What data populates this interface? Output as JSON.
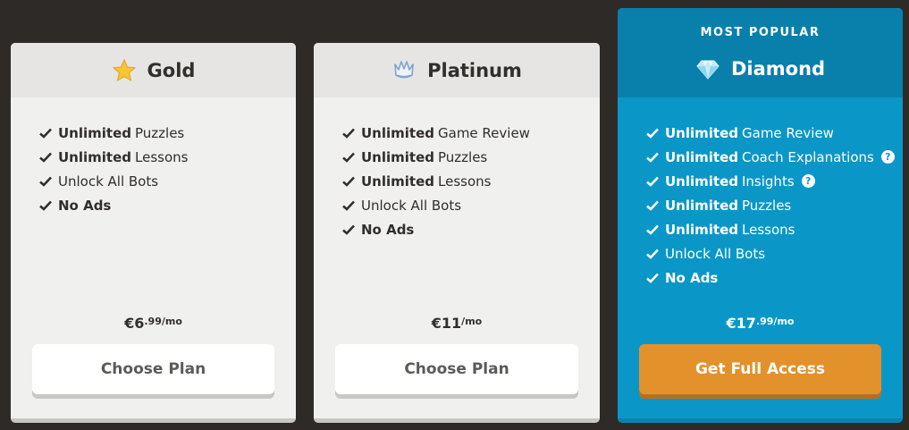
{
  "plans": [
    {
      "name": "Gold",
      "icon": "star-icon",
      "features": [
        {
          "bold": "Unlimited",
          "text": "Puzzles"
        },
        {
          "bold": "Unlimited",
          "text": "Lessons"
        },
        {
          "bold": "",
          "text": "Unlock All Bots"
        },
        {
          "bold": "No Ads",
          "text": ""
        }
      ],
      "price_main": "€6",
      "price_cents": ".99/mo",
      "button": "Choose Plan"
    },
    {
      "name": "Platinum",
      "icon": "crown-icon",
      "features": [
        {
          "bold": "Unlimited",
          "text": "Game Review"
        },
        {
          "bold": "Unlimited",
          "text": "Puzzles"
        },
        {
          "bold": "Unlimited",
          "text": "Lessons"
        },
        {
          "bold": "",
          "text": "Unlock All Bots"
        },
        {
          "bold": "No Ads",
          "text": ""
        }
      ],
      "price_main": "€11",
      "price_cents": "/mo",
      "button": "Choose Plan"
    },
    {
      "badge": "MOST POPULAR",
      "name": "Diamond",
      "icon": "diamond-icon",
      "features": [
        {
          "bold": "Unlimited",
          "text": "Game Review"
        },
        {
          "bold": "Unlimited",
          "text": "Coach Explanations",
          "help": "?"
        },
        {
          "bold": "Unlimited",
          "text": "Insights",
          "help": "?"
        },
        {
          "bold": "Unlimited",
          "text": "Puzzles"
        },
        {
          "bold": "Unlimited",
          "text": "Lessons"
        },
        {
          "bold": "",
          "text": "Unlock All Bots"
        },
        {
          "bold": "No Ads",
          "text": ""
        }
      ],
      "price_main": "€17",
      "price_cents": ".99/mo",
      "button": "Get Full Access"
    }
  ],
  "colors": {
    "background": "#2e2a27",
    "card": "#f0f0ef",
    "diamond": "#0a97c8",
    "accent_button": "#e2912b"
  }
}
